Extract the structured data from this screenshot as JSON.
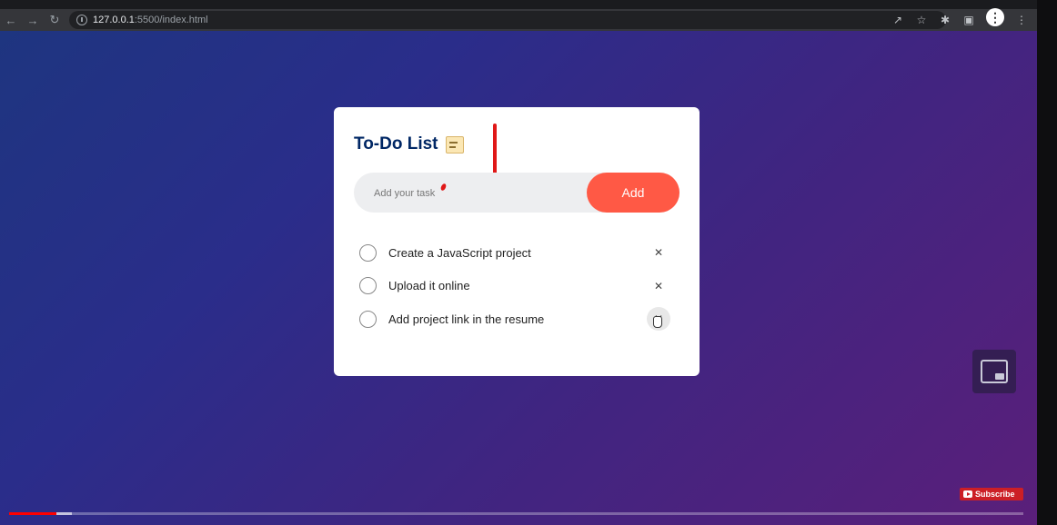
{
  "browser": {
    "url_host": "127.0.0.1",
    "url_rest": ":5500/index.html"
  },
  "app": {
    "title": "To-Do List",
    "title_icon": "note-icon",
    "input_placeholder": "Add your task",
    "add_label": "Add",
    "accent_color": "#ff5945",
    "title_color": "#002765"
  },
  "tasks": [
    {
      "text": "Create a JavaScript project",
      "done": false
    },
    {
      "text": "Upload it online",
      "done": false
    },
    {
      "text": "Add project link in the resume",
      "done": false
    }
  ],
  "video": {
    "subscribe_label": "Subscribe",
    "progress_played_fraction": 0.047,
    "progress_buffered_fraction": 0.062
  }
}
